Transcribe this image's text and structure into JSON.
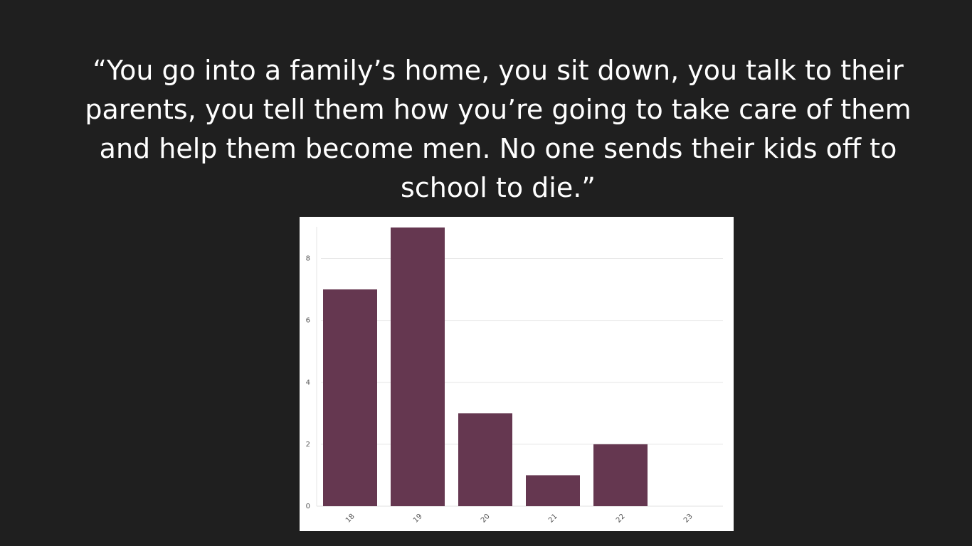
{
  "quote": {
    "text": "“You go into a family’s home, you sit down, you talk to their parents, you tell them how you’re going to take care of them and help them become men. No one sends their kids off to school to die.”"
  },
  "chart_data": {
    "type": "bar",
    "categories": [
      "18",
      "19",
      "20",
      "21",
      "22",
      "23"
    ],
    "values": [
      7,
      9,
      3,
      1,
      2,
      0
    ],
    "title": "",
    "xlabel": "",
    "ylabel": "",
    "ylim": [
      0,
      9
    ],
    "yticks": [
      0,
      2,
      4,
      6,
      8
    ],
    "grid": true,
    "bar_color": "#653750"
  }
}
